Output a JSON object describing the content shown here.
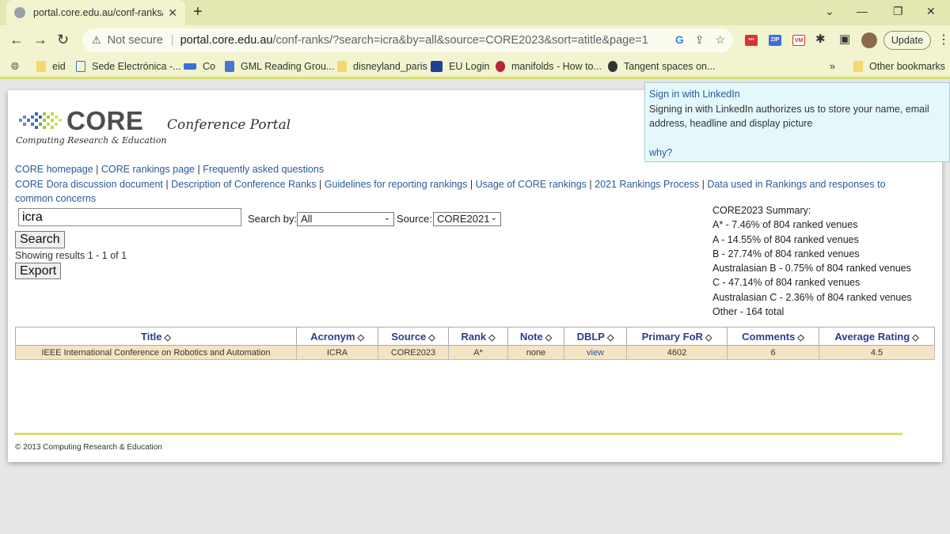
{
  "browser": {
    "tab_title": "portal.core.edu.au/conf-ranks/?se",
    "not_secure": "Not secure",
    "url_host": "portal.core.edu.au",
    "url_path": "/conf-ranks/?search=icra&by=all&source=CORE2023&sort=atitle&page=1",
    "update_label": "Update",
    "bookmarks": [
      "eid",
      "Sede Electrónica -...",
      "Co",
      "GML Reading Grou...",
      "disneyland_paris",
      "EU Login",
      "manifolds - How to...",
      "Tangent spaces on...",
      "Other bookmarks"
    ],
    "ext_zip": "ZIP",
    "ext_vm": "VM"
  },
  "header": {
    "logo_word": "CORE",
    "logo_sub": "Computing Research & Education",
    "portal_title": "Conference Portal"
  },
  "links": {
    "core_homepage": "CORE homepage",
    "core_rankings_page": "CORE rankings page",
    "faq": "Frequently asked questions",
    "dora": "CORE Dora discussion document",
    "description": "Description of Conference Ranks",
    "guidelines": "Guidelines for reporting rankings",
    "usage": "Usage of CORE rankings",
    "process2021": "2021 Rankings Process",
    "data_used": "Data used in Rankings and responses to common concerns"
  },
  "search": {
    "value": "icra",
    "search_by_label": "Search by:",
    "search_by_value": "All",
    "source_label": "Source:",
    "source_value": "CORE2021",
    "search_button": "Search",
    "results_text": "Showing results 1 - 1 of 1",
    "export_button": "Export"
  },
  "summary": {
    "title": "CORE2023 Summary:",
    "lines": [
      "A* - 7.46% of 804 ranked venues",
      "A - 14.55% of 804 ranked venues",
      "B - 27.74% of 804 ranked venues",
      "Australasian B - 0.75% of 804 ranked venues",
      "C - 47.14% of 804 ranked venues",
      "Australasian C - 2.36% of 804 ranked venues",
      "Other - 164 total"
    ]
  },
  "table": {
    "headers": [
      "Title",
      "Acronym",
      "Source",
      "Rank",
      "Note",
      "DBLP",
      "Primary FoR",
      "Comments",
      "Average Rating"
    ],
    "rows": [
      [
        "IEEE International Conference on Robotics and Automation",
        "ICRA",
        "CORE2023",
        "A*",
        "none",
        "view",
        "4602",
        "6",
        "4.5"
      ]
    ]
  },
  "footer": "© 2013 Computing Research & Education",
  "linkedin": {
    "title": "Sign in with LinkedIn",
    "body": "Signing in with LinkedIn authorizes us to store your name, email address, headline and display picture",
    "why": "why?"
  }
}
